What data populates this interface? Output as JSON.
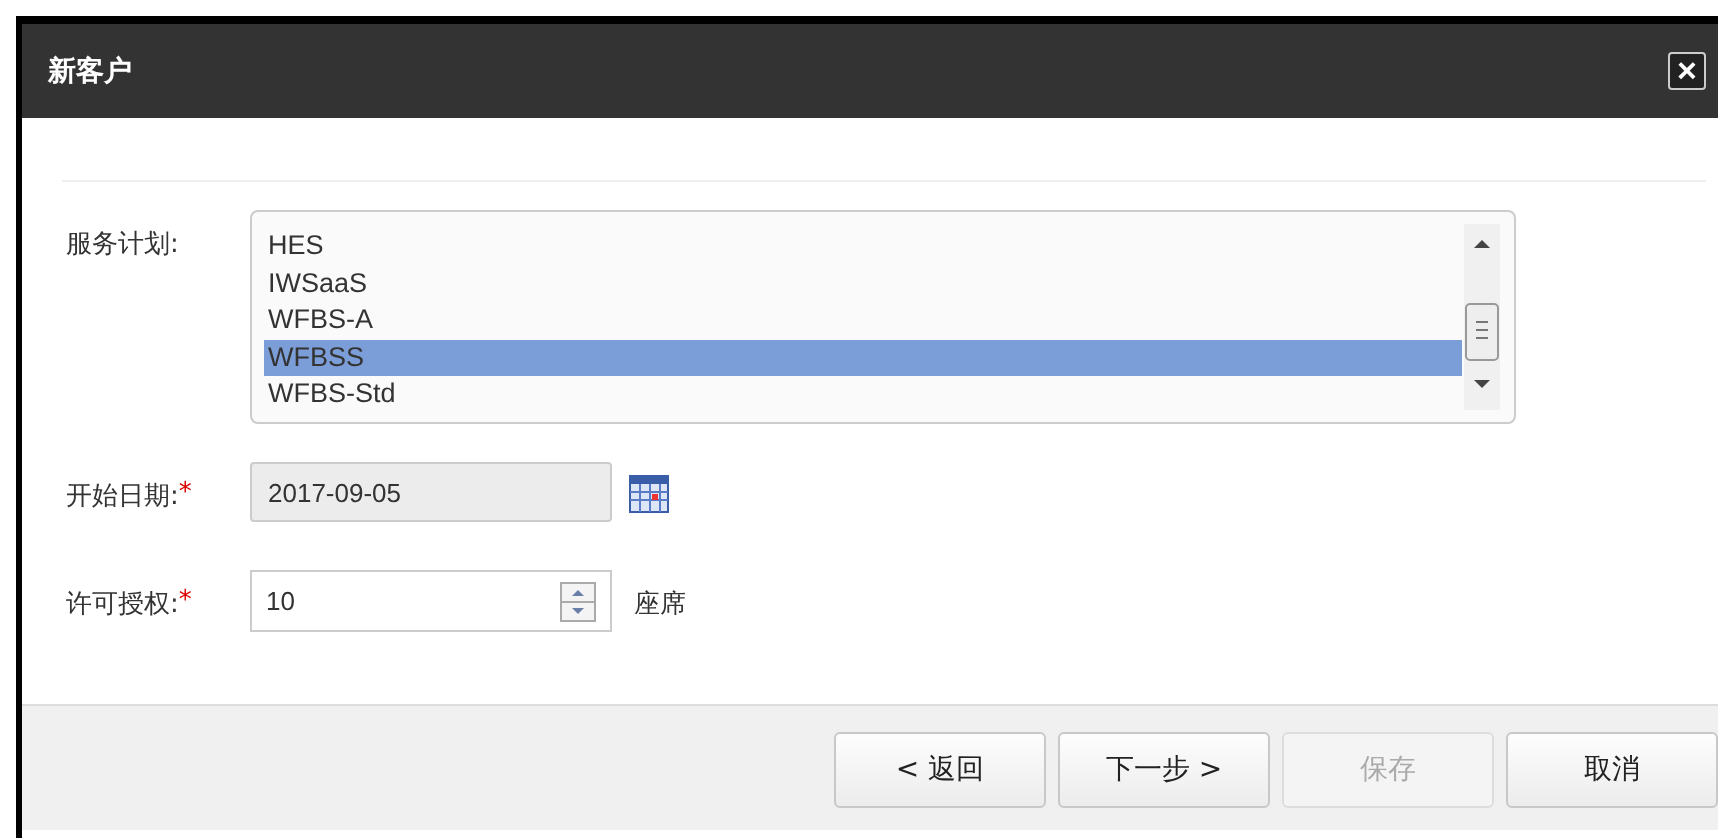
{
  "window": {
    "title": "新客户",
    "close": "×"
  },
  "fields": [
    {
      "kind": "listbox",
      "label": "服务计划:",
      "options": [
        {
          "label": "HES",
          "selected": false
        },
        {
          "label": "IWSaaS",
          "selected": false
        },
        {
          "label": "WFBS-A",
          "selected": false
        },
        {
          "label": "WFBSS",
          "selected": true
        },
        {
          "label": "WFBS-Std",
          "selected": false
        }
      ]
    },
    {
      "kind": "date",
      "label": "开始日期:",
      "required_mark": "*",
      "value": "2017-09-05",
      "disabled": true
    },
    {
      "kind": "number",
      "label": "许可授权:",
      "required_mark": "*",
      "value": "10",
      "unit": "座席"
    }
  ],
  "buttons": [
    {
      "label": "< 返回",
      "disabled": false
    },
    {
      "label": "下一步 >",
      "disabled": false
    },
    {
      "label": "保存",
      "disabled": true
    },
    {
      "label": "取消",
      "disabled": false
    }
  ]
}
